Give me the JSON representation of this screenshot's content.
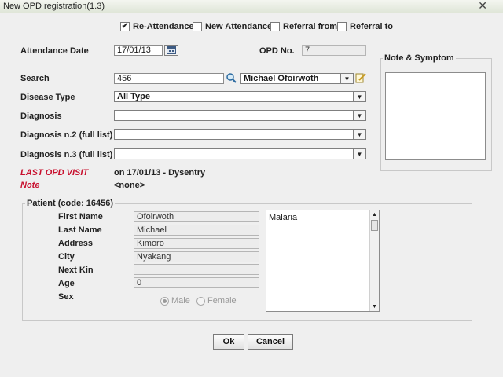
{
  "window": {
    "title": "New OPD registration(1.3)",
    "close_glyph": "✕"
  },
  "attendance": {
    "re_attendance": {
      "label": "Re-Attendance",
      "checked": true
    },
    "new_attendance": {
      "label": "New Attendance",
      "checked": false
    },
    "referral_from": {
      "label": "Referral from",
      "checked": false
    },
    "referral_to": {
      "label": "Referral to",
      "checked": false
    }
  },
  "form": {
    "attendance_date_label": "Attendance Date",
    "attendance_date_value": "17/01/13",
    "opd_no_label": "OPD No.",
    "opd_no_value": "7",
    "search_label": "Search",
    "search_value": "456",
    "patient_combo": "Michael Ofoirwoth",
    "disease_type_label": "Disease Type",
    "disease_type_value": "All Type",
    "diagnosis_label": "Diagnosis",
    "diagnosis_value": "",
    "diagnosis2_label": "Diagnosis n.2 (full list)",
    "diagnosis2_value": "",
    "diagnosis3_label": "Diagnosis n.3 (full list)",
    "diagnosis3_value": "",
    "last_visit_label": "LAST OPD VISIT",
    "last_visit_value": "on 17/01/13 - Dysentry",
    "note_label": "Note",
    "note_value": "<none>"
  },
  "note_symptom": {
    "title": "Note & Symptom",
    "text": ""
  },
  "patient": {
    "title": "Patient (code: 16456)",
    "first_name_label": "First Name",
    "first_name": "Ofoirwoth",
    "last_name_label": "Last Name",
    "last_name": "Michael",
    "address_label": "Address",
    "address": "Kimoro",
    "city_label": "City",
    "city": "Nyakang",
    "next_kin_label": "Next Kin",
    "next_kin": "",
    "age_label": "Age",
    "age": "0",
    "sex_label": "Sex",
    "sex_male": "Male",
    "sex_female": "Female",
    "sex_selected": "Male",
    "notes_text": "Malaria"
  },
  "buttons": {
    "ok": "Ok",
    "cancel": "Cancel"
  }
}
